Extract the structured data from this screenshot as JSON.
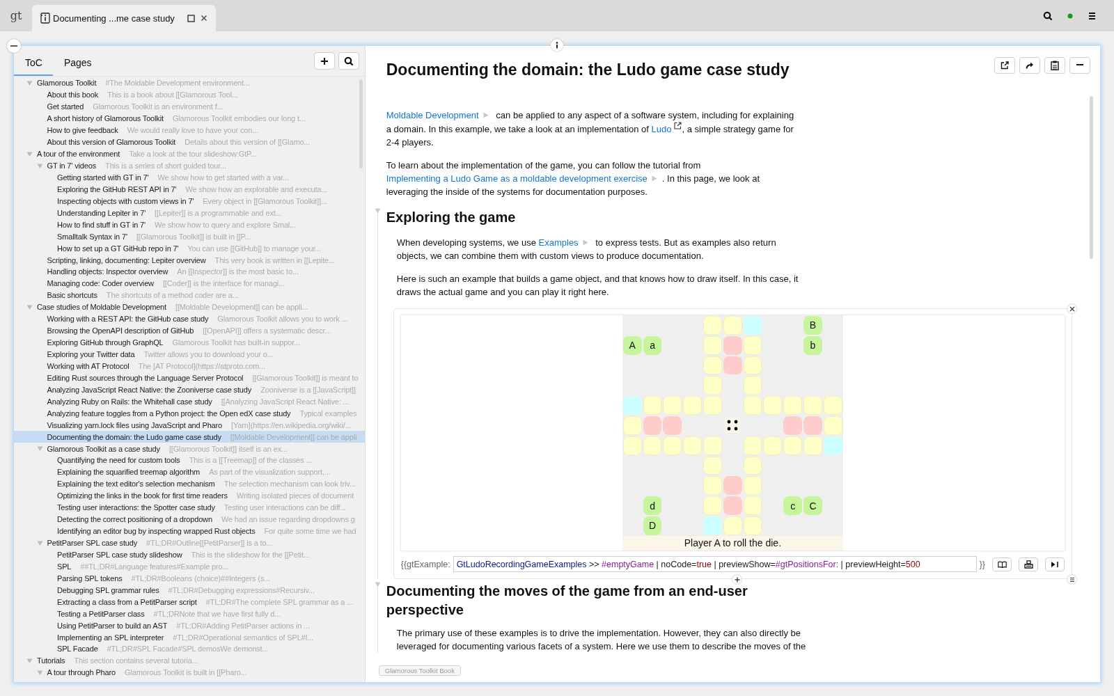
{
  "tabs": [
    {
      "kind": "logo",
      "label": "gt",
      "selected": false
    },
    {
      "kind": "page",
      "label": "Documenting ...me case study",
      "selected": true
    }
  ],
  "sidebar": {
    "tabs": [
      {
        "label": "ToC",
        "selected": true
      },
      {
        "label": "Pages",
        "selected": false
      }
    ],
    "toc": [
      {
        "title": "Glamorous Toolkit",
        "summary": "#The Moldable Development environment...",
        "expanded": true,
        "selected": false,
        "children": [
          {
            "title": "About this book",
            "summary": "This is a book about [[Glamorous Tool...",
            "selected": false
          },
          {
            "title": "Get started",
            "summary": "Glamorous Toolkit is an environment f...",
            "selected": false
          },
          {
            "title": "A short history of Glamorous Toolkit",
            "summary": "Glamorous Toolkit embodies our long t...",
            "selected": false
          },
          {
            "title": "How to give feedback",
            "summary": "We would really love to have your con...",
            "selected": false
          },
          {
            "title": "About this version of Glamorous Toolkit",
            "summary": "Details about this version of [[Glamo...",
            "selected": false
          }
        ]
      },
      {
        "title": "A tour of the environment",
        "summary": "Take a look at the tour slideshow:GtP...",
        "expanded": true,
        "selected": false,
        "children": [
          {
            "title": "GT in 7' videos",
            "summary": "This is a series of short guided tour...",
            "expanded": true,
            "selected": false,
            "children": [
              {
                "title": "Getting started with GT in 7'",
                "summary": "We show how to get started with a var...",
                "selected": false
              },
              {
                "title": "Exploring the GitHub REST API in 7'",
                "summary": "We show how an explorable and executa...",
                "selected": false
              },
              {
                "title": "Inspecting objects with custom views in 7'",
                "summary": "Every object in [[Glamorous Toolkit]]...",
                "selected": false
              },
              {
                "title": "Understanding Lepiter in 7'",
                "summary": "[[Lepiter]] is a programmable and ext...",
                "selected": false
              },
              {
                "title": "How to find stuff in GT in 7'",
                "summary": "We show how to query and explore Smal...",
                "selected": false
              },
              {
                "title": "Smalltalk Syntax in 7'",
                "summary": "[[Glamorous Toolkit]] is built in [[P...",
                "selected": false
              },
              {
                "title": "How to set up a GT GitHub repo in 7'",
                "summary": "You can use [[GitHub]] to manage your...",
                "selected": false
              }
            ]
          },
          {
            "title": "Scripting, linking, documenting: Lepiter overview",
            "summary": "This very book is written in [[Lepite...",
            "selected": false
          },
          {
            "title": "Handling objects: Inspector overview",
            "summary": "An [[Inspector]] is the most basic to...",
            "selected": false
          },
          {
            "title": "Managing code: Coder overview",
            "summary": "[[Coder]] is the interface for managi...",
            "selected": false
          },
          {
            "title": "Basic shortcuts",
            "summary": "The shortcuts of a method coder are a...",
            "selected": false
          }
        ]
      },
      {
        "title": "Case studies of Moldable Development",
        "summary": "[[Moldable Development]] can be appli...",
        "expanded": true,
        "selected": false,
        "children": [
          {
            "title": "Working with a REST API: the GitHub case study",
            "summary": "Glamorous Toolkit allows you to work ...",
            "selected": false
          },
          {
            "title": "Browsing the OpenAPI description of GitHub",
            "summary": "[[OpenAPI]] offers a systematic descr...",
            "selected": false
          },
          {
            "title": "Exploring GitHub through GraphQL",
            "summary": "Glamorous Toolkit has built-in suppor...",
            "selected": false
          },
          {
            "title": "Exploring your Twitter data",
            "summary": "Twitter allows you to download your o...",
            "selected": false
          },
          {
            "title": "Working with AT Protocol",
            "summary": "The [AT Protocol](https://atproto.com...",
            "selected": false
          },
          {
            "title": "Editing Rust sources through the Language Server Protocol",
            "summary": "[[Glamorous Toolkit]] is meant to",
            "selected": false
          },
          {
            "title": "Analyzing JavaScript React Native: the Zooniverse case study",
            "summary": "Zooniverse is a [[JavaScript]]",
            "selected": false
          },
          {
            "title": "Analyzing Ruby on Rails: the Whitehall case study",
            "summary": "[[Analyzing JavaScript React Native: ...",
            "selected": false
          },
          {
            "title": "Analyzing feature toggles from a Python project: the Open edX case study",
            "summary": "Typical examples",
            "selected": false
          },
          {
            "title": "Visualizing yarn.lock files using JavaScript and Pharo",
            "summary": "[Yarn](https://en.wikipedia.org/wiki/...",
            "selected": false
          },
          {
            "title": "Documenting the domain: the Ludo game case study",
            "summary": "[[Moldable Development]] can be appli",
            "selected": true
          },
          {
            "title": "Glamorous Toolkit as a case study",
            "summary": "[[Glamorous Toolkit]] itself is an ex...",
            "expanded": true,
            "selected": false,
            "children": [
              {
                "title": "Quantifying the need for custom tools",
                "summary": "This is a [[Treemap]] of the classes ...",
                "selected": false
              },
              {
                "title": "Explaining the squarified treemap algorithm",
                "summary": "As part of the visualization support,...",
                "selected": false
              },
              {
                "title": "Explaining the text editor's selection mechanism",
                "summary": "The selection mechanism can look triv...",
                "selected": false
              },
              {
                "title": "Optimizing the links in the book for first time readers",
                "summary": "Writing isolated pieces of document",
                "selected": false
              },
              {
                "title": "Testing user interactions: the Spotter case study",
                "summary": "Testing user interactions can be diff...",
                "selected": false
              },
              {
                "title": "Detecting the correct positioning of a dropdown",
                "summary": "We had an issue regarding dropdowns g",
                "selected": false
              },
              {
                "title": "Identifying an editor bug by inspecting wrapped Rust objects",
                "summary": "For quite some time we had",
                "selected": false
              }
            ]
          },
          {
            "title": "PetitParser SPL case study",
            "summary": "#TL;DR#Outline[[PetitParser]] is a to...",
            "expanded": true,
            "selected": false,
            "children": [
              {
                "title": "PetitParser SPL case study slideshow",
                "summary": "This is the slideshow for the [[Petit...",
                "selected": false
              },
              {
                "title": "SPL",
                "summary": "##TL;DR#Language features#Example pro...",
                "selected": false
              },
              {
                "title": "Parsing SPL tokens",
                "summary": "#TL;DR#Booleans (choice)##Integers (s...",
                "selected": false
              },
              {
                "title": "Debugging SPL grammar rules",
                "summary": "#TL;DR#Debugging expressions#Recursiv...",
                "selected": false
              },
              {
                "title": "Extracting a class from a PetitParser script",
                "summary": "#TL;DR#The complete SPL grammar as a ...",
                "selected": false
              },
              {
                "title": "Testing a PetitParser class",
                "summary": "#TL;DRNote that we have first fully d...",
                "selected": false
              },
              {
                "title": "Using PetitParser to build an AST",
                "summary": "#TL;DR#Adding PetitParser actions in ...",
                "selected": false
              },
              {
                "title": "Implementing an SPL interpreter",
                "summary": "#TL;DR#Operational semantics of SPL#I...",
                "selected": false
              },
              {
                "title": "SPL Facade",
                "summary": "#TL;DR#SPL Facade#SPL demosWe demonst...",
                "selected": false
              }
            ]
          }
        ]
      },
      {
        "title": "Tutorials",
        "summary": "This section contains several tutoria...",
        "expanded": true,
        "selected": false,
        "children": [
          {
            "title": "A tour through Pharo",
            "summary": "Glamorous Toolkit is built in [[Pharo...",
            "expanded": true,
            "selected": false
          }
        ]
      }
    ]
  },
  "page": {
    "title": "Documenting the domain: the Ludo game case study",
    "blocks": [
      {
        "kind": "paragraph",
        "parts": [
          {
            "kind": "page_link",
            "text": "Moldable Development"
          },
          {
            "kind": "text",
            "text": " can be applied to any aspect of a software system, including for explaining a domain. In this example, we take a look at an implementation of "
          },
          {
            "kind": "web_link",
            "text": "Ludo"
          },
          {
            "kind": "text",
            "text": ", a simple strategy game for 2-4 players."
          }
        ]
      },
      {
        "kind": "paragraph",
        "parts": [
          {
            "kind": "text",
            "text": "To learn about the implementation of the game, you can follow the tutorial from "
          },
          {
            "kind": "page_link",
            "text": "Implementing a Ludo Game as a moldable development exercise"
          },
          {
            "kind": "text",
            "text": ". In this page, we look at leveraging the inside of the systems for documentation purposes."
          }
        ]
      },
      {
        "kind": "section",
        "heading": "Exploring the game",
        "expanded": true,
        "blocks": [
          {
            "kind": "paragraph",
            "parts": [
              {
                "kind": "text",
                "text": "When developing systems, we use "
              },
              {
                "kind": "page_link",
                "text": "Examples"
              },
              {
                "kind": "text",
                "text": " to express tests. But as examples also return objects, we can combine them with custom views to produce documentation."
              }
            ]
          },
          {
            "kind": "paragraph",
            "parts": [
              {
                "kind": "text",
                "text": "Here is such an example that builds a game object, and that knows how to draw itself. In this case, it draws the actual game and you can play it right here."
              }
            ]
          },
          {
            "kind": "example",
            "board": [
              [
                {
                  "kind": "none"
                },
                {
                  "kind": "none"
                },
                {
                  "kind": "none"
                },
                {
                  "kind": "none"
                },
                {
                  "kind": "track"
                },
                {
                  "kind": "track"
                },
                {
                  "kind": "start"
                },
                {
                  "kind": "none"
                },
                {
                  "kind": "none"
                },
                {
                  "kind": "token",
                  "label": "B"
                },
                {
                  "kind": "none"
                }
              ],
              [
                {
                  "kind": "token",
                  "label": "A"
                },
                {
                  "kind": "token",
                  "label": "a"
                },
                {
                  "kind": "none"
                },
                {
                  "kind": "none"
                },
                {
                  "kind": "track"
                },
                {
                  "kind": "home"
                },
                {
                  "kind": "track"
                },
                {
                  "kind": "none"
                },
                {
                  "kind": "none"
                },
                {
                  "kind": "token",
                  "label": "b"
                },
                {
                  "kind": "none"
                }
              ],
              [
                {
                  "kind": "none"
                },
                {
                  "kind": "none"
                },
                {
                  "kind": "none"
                },
                {
                  "kind": "none"
                },
                {
                  "kind": "track"
                },
                {
                  "kind": "home"
                },
                {
                  "kind": "track"
                },
                {
                  "kind": "none"
                },
                {
                  "kind": "none"
                },
                {
                  "kind": "none"
                },
                {
                  "kind": "none"
                }
              ],
              [
                {
                  "kind": "none"
                },
                {
                  "kind": "none"
                },
                {
                  "kind": "none"
                },
                {
                  "kind": "none"
                },
                {
                  "kind": "track"
                },
                {
                  "kind": "none"
                },
                {
                  "kind": "track"
                },
                {
                  "kind": "none"
                },
                {
                  "kind": "none"
                },
                {
                  "kind": "none"
                },
                {
                  "kind": "none"
                }
              ],
              [
                {
                  "kind": "start"
                },
                {
                  "kind": "track"
                },
                {
                  "kind": "track"
                },
                {
                  "kind": "track"
                },
                {
                  "kind": "track"
                },
                {
                  "kind": "none"
                },
                {
                  "kind": "track"
                },
                {
                  "kind": "track"
                },
                {
                  "kind": "track"
                },
                {
                  "kind": "track"
                },
                {
                  "kind": "track"
                }
              ],
              [
                {
                  "kind": "track"
                },
                {
                  "kind": "home"
                },
                {
                  "kind": "home"
                },
                {
                  "kind": "none"
                },
                {
                  "kind": "none"
                },
                {
                  "kind": "die"
                },
                {
                  "kind": "none"
                },
                {
                  "kind": "none"
                },
                {
                  "kind": "home"
                },
                {
                  "kind": "home"
                },
                {
                  "kind": "track"
                }
              ],
              [
                {
                  "kind": "track"
                },
                {
                  "kind": "track"
                },
                {
                  "kind": "track"
                },
                {
                  "kind": "track"
                },
                {
                  "kind": "track"
                },
                {
                  "kind": "none"
                },
                {
                  "kind": "track"
                },
                {
                  "kind": "track"
                },
                {
                  "kind": "track"
                },
                {
                  "kind": "track"
                },
                {
                  "kind": "start"
                }
              ],
              [
                {
                  "kind": "none"
                },
                {
                  "kind": "none"
                },
                {
                  "kind": "none"
                },
                {
                  "kind": "none"
                },
                {
                  "kind": "track"
                },
                {
                  "kind": "none"
                },
                {
                  "kind": "track"
                },
                {
                  "kind": "none"
                },
                {
                  "kind": "none"
                },
                {
                  "kind": "none"
                },
                {
                  "kind": "none"
                }
              ],
              [
                {
                  "kind": "none"
                },
                {
                  "kind": "none"
                },
                {
                  "kind": "none"
                },
                {
                  "kind": "none"
                },
                {
                  "kind": "track"
                },
                {
                  "kind": "home"
                },
                {
                  "kind": "track"
                },
                {
                  "kind": "none"
                },
                {
                  "kind": "none"
                },
                {
                  "kind": "none"
                },
                {
                  "kind": "none"
                }
              ],
              [
                {
                  "kind": "none"
                },
                {
                  "kind": "token",
                  "label": "d"
                },
                {
                  "kind": "none"
                },
                {
                  "kind": "none"
                },
                {
                  "kind": "track"
                },
                {
                  "kind": "home"
                },
                {
                  "kind": "track"
                },
                {
                  "kind": "none"
                },
                {
                  "kind": "token",
                  "label": "c"
                },
                {
                  "kind": "token",
                  "label": "C"
                },
                {
                  "kind": "none"
                }
              ],
              [
                {
                  "kind": "none"
                },
                {
                  "kind": "token",
                  "label": "D"
                },
                {
                  "kind": "none"
                },
                {
                  "kind": "none"
                },
                {
                  "kind": "start"
                },
                {
                  "kind": "track"
                },
                {
                  "kind": "track"
                },
                {
                  "kind": "none"
                },
                {
                  "kind": "none"
                },
                {
                  "kind": "none"
                },
                {
                  "kind": "none"
                }
              ]
            ],
            "status": "Player A to roll the die.",
            "code": {
              "prefix": "{{gtExample:",
              "suffix": "}}",
              "tokens": [
                {
                  "kind": "class",
                  "text": "GtLudoRecordingGameExamples"
                },
                {
                  "kind": "plain",
                  "text": " >> "
                },
                {
                  "kind": "symbol",
                  "text": "#emptyGame"
                },
                {
                  "kind": "plain",
                  "text": " | noCode="
                },
                {
                  "kind": "literal",
                  "text": "true"
                },
                {
                  "kind": "plain",
                  "text": " | previewShow="
                },
                {
                  "kind": "symbol",
                  "text": "#gtPositionsFor:"
                },
                {
                  "kind": "plain",
                  "text": " | previewHeight="
                },
                {
                  "kind": "literal",
                  "text": "500"
                }
              ]
            }
          }
        ]
      },
      {
        "kind": "section",
        "heading": "Documenting the moves of the game from an end-user perspective",
        "expanded": true,
        "blocks": [
          {
            "kind": "paragraph",
            "parts": [
              {
                "kind": "text",
                "text": "The primary use of these examples is to drive the implementation. However, they can also directly be leveraged for documenting various facets of a system. Here we use them to describe the moves of the"
              }
            ]
          }
        ]
      }
    ]
  },
  "footer_label": "Glamorous Toolkit Book"
}
